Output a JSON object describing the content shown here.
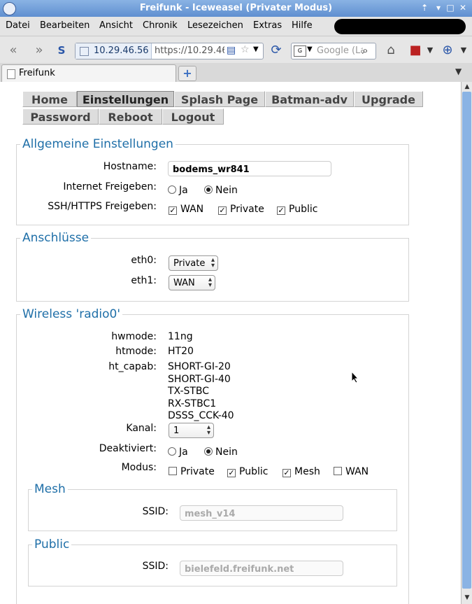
{
  "window": {
    "title": "Freifunk - Iceweasel (Privater Modus)"
  },
  "menubar": {
    "items": [
      "Datei",
      "Bearbeiten",
      "Ansicht",
      "Chronik",
      "Lesezeichen",
      "Extras",
      "Hilfe"
    ]
  },
  "navbar": {
    "identity_ip": "10.29.46.56",
    "url": "https://10.29.46",
    "search_placeholder": "Google (La"
  },
  "tabs": [
    {
      "title": "Freifunk"
    }
  ],
  "router_menu": {
    "row1": [
      "Home",
      "Einstellungen",
      "Splash Page",
      "Batman-adv",
      "Upgrade"
    ],
    "row2": [
      "Password",
      "Reboot",
      "Logout"
    ],
    "active": "Einstellungen"
  },
  "general": {
    "legend": "Allgemeine Einstellungen",
    "hostname_label": "Hostname:",
    "hostname_value": "bodems_wr841",
    "internet_label": "Internet Freigeben:",
    "opt_ja": "Ja",
    "opt_nein": "Nein",
    "internet_selected": "Nein",
    "ssh_label": "SSH/HTTPS Freigeben:",
    "ssh_options": [
      {
        "label": "WAN",
        "checked": true
      },
      {
        "label": "Private",
        "checked": true
      },
      {
        "label": "Public",
        "checked": true
      }
    ]
  },
  "ports": {
    "legend": "Anschlüsse",
    "eth0_label": "eth0:",
    "eth0_value": "Private",
    "eth1_label": "eth1:",
    "eth1_value": "WAN"
  },
  "wireless": {
    "legend": "Wireless 'radio0'",
    "hwmode_label": "hwmode:",
    "hwmode_value": "11ng",
    "htmode_label": "htmode:",
    "htmode_value": "HT20",
    "htcapab_label": "ht_capab:",
    "htcapab_values": [
      "SHORT-GI-20",
      "SHORT-GI-40",
      "TX-STBC",
      "RX-STBC1",
      "DSSS_CCK-40"
    ],
    "kanal_label": "Kanal:",
    "kanal_value": "1",
    "deakt_label": "Deaktiviert:",
    "opt_ja": "Ja",
    "opt_nein": "Nein",
    "deakt_selected": "Nein",
    "modus_label": "Modus:",
    "modus_options": [
      {
        "label": "Private",
        "checked": false
      },
      {
        "label": "Public",
        "checked": true
      },
      {
        "label": "Mesh",
        "checked": true
      },
      {
        "label": "WAN",
        "checked": false
      }
    ],
    "mesh": {
      "legend": "Mesh",
      "ssid_label": "SSID:",
      "ssid_value": "mesh_v14"
    },
    "public": {
      "legend": "Public",
      "ssid_label": "SSID:",
      "ssid_value": "bielefeld.freifunk.net"
    }
  }
}
